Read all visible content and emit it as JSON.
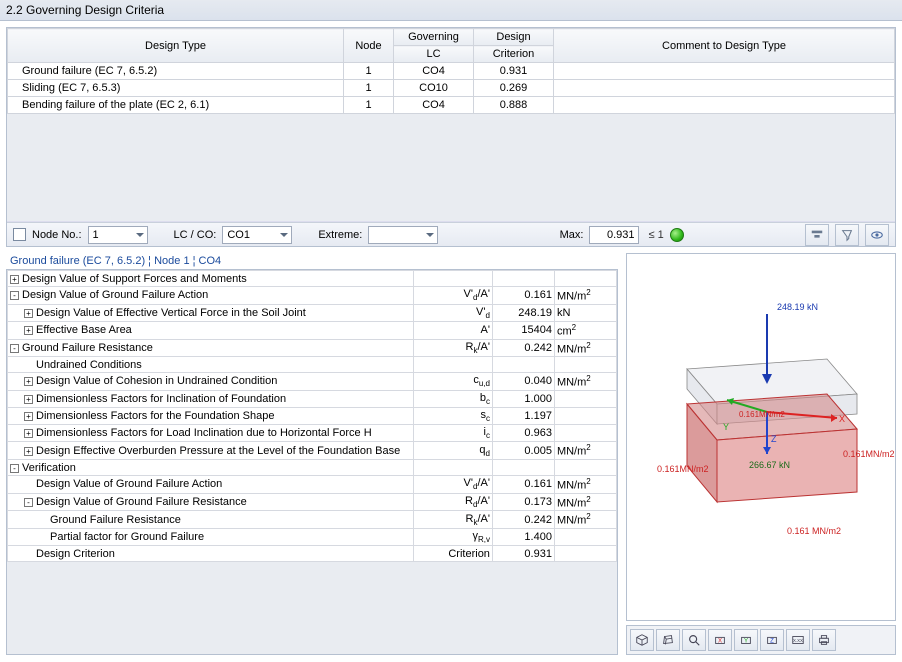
{
  "title": "2.2 Governing Design Criteria",
  "topGrid": {
    "headers": {
      "designType": "Design Type",
      "node": "Node",
      "govLC": "Governing\nLC",
      "designCrit": "Design\nCriterion",
      "comment": "Comment to Design Type"
    },
    "rows": [
      {
        "designType": "Ground failure (EC 7, 6.5.2)",
        "node": "1",
        "lc": "CO4",
        "crit": "0.931",
        "comment": ""
      },
      {
        "designType": "Sliding (EC 7, 6.5.3)",
        "node": "1",
        "lc": "CO10",
        "crit": "0.269",
        "comment": ""
      },
      {
        "designType": "Bending failure of the plate (EC 2, 6.1)",
        "node": "1",
        "lc": "CO4",
        "crit": "0.888",
        "comment": ""
      }
    ]
  },
  "filter": {
    "nodeLabel": "Node No.:",
    "nodeVal": "1",
    "lcLabel": "LC / CO:",
    "lcVal": "CO1",
    "extremeLabel": "Extreme:",
    "extremeVal": "",
    "maxLabel": "Max:",
    "maxVal": "0.931",
    "maxCond": "≤ 1"
  },
  "detailHeader": "Ground failure (EC 7, 6.5.2) ¦ Node 1 ¦ CO4",
  "details": [
    {
      "lvl": 0,
      "exp": "+",
      "label": "Design Value of Support Forces and Moments"
    },
    {
      "lvl": 0,
      "exp": "-",
      "label": "Design Value of Ground Failure Action",
      "sym": "V'd/A'",
      "val": "0.161",
      "unit": "MN/m²"
    },
    {
      "lvl": 1,
      "exp": "+",
      "label": "Design Value of Effective Vertical Force in the Soil Joint",
      "sym": "V'd",
      "val": "248.19",
      "unit": "kN"
    },
    {
      "lvl": 1,
      "exp": "+",
      "label": "Effective Base Area",
      "sym": "A'",
      "val": "15404",
      "unit": "cm²"
    },
    {
      "lvl": 0,
      "exp": "-",
      "label": "Ground Failure Resistance",
      "sym": "Rk/A'",
      "val": "0.242",
      "unit": "MN/m²"
    },
    {
      "lvl": 1,
      "exp": "",
      "label": "Undrained Conditions"
    },
    {
      "lvl": 1,
      "exp": "+",
      "label": "Design Value of Cohesion in Undrained Condition",
      "sym": "cu,d",
      "val": "0.040",
      "unit": "MN/m²"
    },
    {
      "lvl": 1,
      "exp": "+",
      "label": "Dimensionless Factors for Inclination of Foundation",
      "sym": "bc",
      "val": "1.000",
      "unit": ""
    },
    {
      "lvl": 1,
      "exp": "+",
      "label": "Dimensionless Factors for the Foundation Shape",
      "sym": "sc",
      "val": "1.197",
      "unit": ""
    },
    {
      "lvl": 1,
      "exp": "+",
      "label": "Dimensionless Factors for Load Inclination due to Horizontal Force H",
      "sym": "ic",
      "val": "0.963",
      "unit": ""
    },
    {
      "lvl": 1,
      "exp": "+",
      "label": "Design Effective Overburden Pressure at the Level of the Foundation Base",
      "sym": "qd",
      "val": "0.005",
      "unit": "MN/m²"
    },
    {
      "lvl": 0,
      "exp": "-",
      "label": "Verification"
    },
    {
      "lvl": 1,
      "exp": "",
      "label": "Design Value of Ground Failure Action",
      "sym": "V'd/A'",
      "val": "0.161",
      "unit": "MN/m²"
    },
    {
      "lvl": 1,
      "exp": "-",
      "label": "Design Value of Ground Failure Resistance",
      "sym": "Rd/A'",
      "val": "0.173",
      "unit": "MN/m²"
    },
    {
      "lvl": 2,
      "exp": "",
      "label": "Ground Failure Resistance",
      "sym": "Rk/A'",
      "val": "0.242",
      "unit": "MN/m²"
    },
    {
      "lvl": 2,
      "exp": "",
      "label": "Partial factor for Ground Failure",
      "sym": "γR,v",
      "val": "1.400",
      "unit": ""
    },
    {
      "lvl": 1,
      "exp": "",
      "label": "Design Criterion",
      "sym": "Criterion",
      "val": "0.931",
      "unit": ""
    }
  ],
  "viewer": {
    "labels": {
      "topForce": "248.19 kN",
      "leftStress": "0.161MN/m2",
      "rightStress": "0.161MN/m2",
      "bottomStress": "0.161 MN/m2",
      "centerStress": "0.161MN/m2",
      "centerForce": "266.67 kN",
      "x": "X",
      "y": "Y",
      "z": "Z"
    }
  },
  "toolbarIcons": [
    "cube-iso-icon",
    "cube-persp-icon",
    "magnifier-icon",
    "view-x-icon",
    "view-y-icon",
    "view-z-icon",
    "numeric-icon",
    "print-icon"
  ]
}
